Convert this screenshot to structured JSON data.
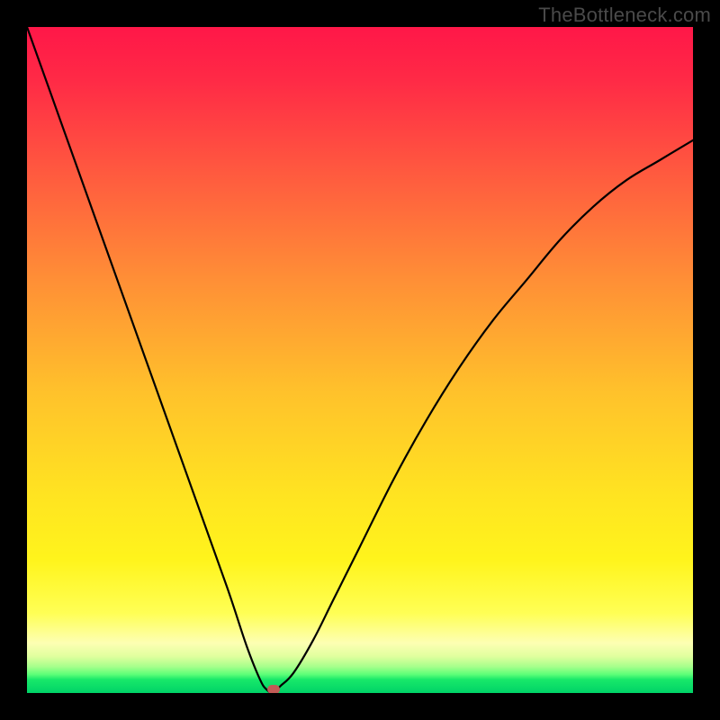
{
  "watermark": "TheBottleneck.com",
  "chart_data": {
    "type": "line",
    "title": "",
    "xlabel": "",
    "ylabel": "",
    "xlim": [
      0,
      100
    ],
    "ylim": [
      0,
      100
    ],
    "grid": false,
    "legend": false,
    "background": {
      "type": "vertical-gradient",
      "meaning": "bottleneck-severity (red=high, green=low)"
    },
    "series": [
      {
        "name": "bottleneck-curve",
        "x": [
          0,
          5,
          10,
          15,
          20,
          25,
          30,
          33,
          35,
          36,
          37,
          38,
          40,
          43,
          46,
          50,
          55,
          60,
          65,
          70,
          75,
          80,
          85,
          90,
          95,
          100
        ],
        "values": [
          100,
          86,
          72,
          58,
          44,
          30,
          16,
          7,
          2,
          0.5,
          0,
          1,
          3,
          8,
          14,
          22,
          32,
          41,
          49,
          56,
          62,
          68,
          73,
          77,
          80,
          83
        ]
      }
    ],
    "min_point": {
      "x": 37,
      "y": 0
    },
    "marker": {
      "color": "#c25b56",
      "shape": "rounded-rect"
    }
  },
  "layout": {
    "image_size": 800,
    "plot_inset": 30
  }
}
